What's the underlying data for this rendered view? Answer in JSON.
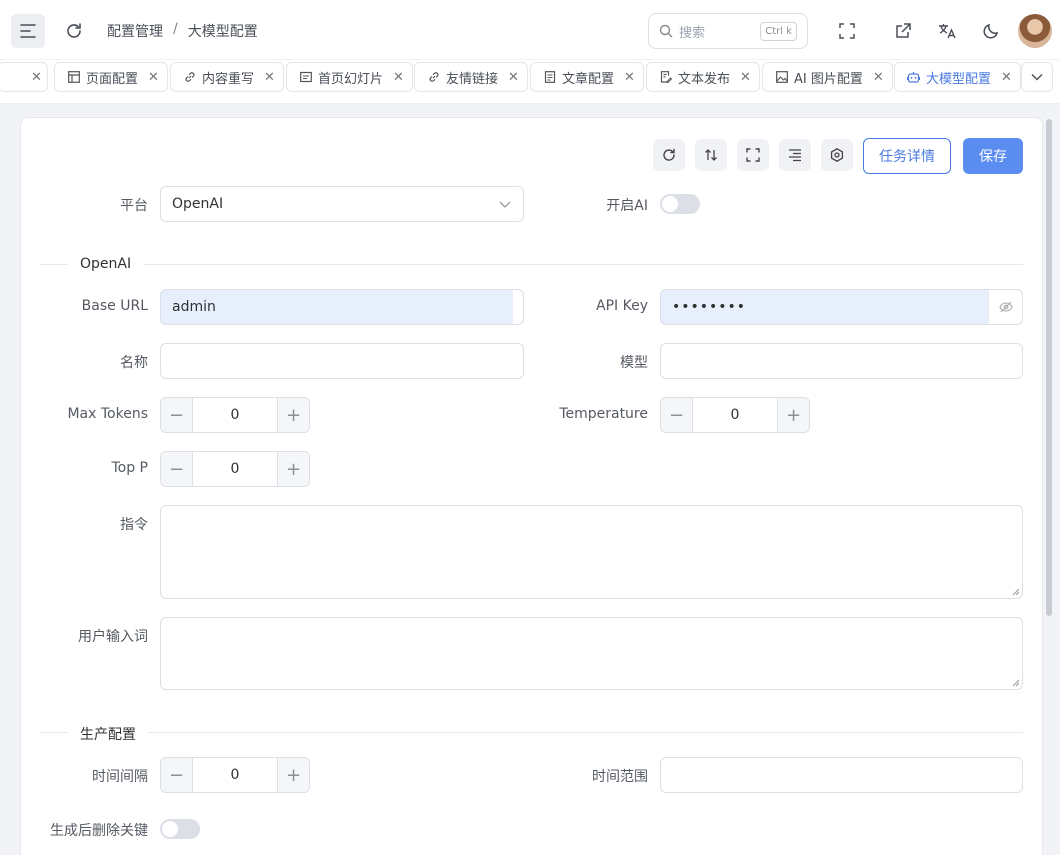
{
  "header": {
    "breadcrumb": [
      "配置管理",
      "大模型配置"
    ],
    "breadcrumb_sep": "/",
    "search": {
      "placeholder": "搜索",
      "shortcut": "Ctrl k"
    }
  },
  "tabs": [
    {
      "label": "页面配置",
      "icon": "layout-icon"
    },
    {
      "label": "内容重写",
      "icon": "link-icon"
    },
    {
      "label": "首页幻灯片",
      "icon": "slideshow-icon"
    },
    {
      "label": "友情链接",
      "icon": "link-icon"
    },
    {
      "label": "文章配置",
      "icon": "document-icon"
    },
    {
      "label": "文本发布",
      "icon": "document-edit-icon"
    },
    {
      "label": "AI 图片配置",
      "icon": "image-icon"
    },
    {
      "label": "大模型配置",
      "icon": "robot-icon",
      "active": true
    }
  ],
  "toolbar": {
    "task_detail_label": "任务详情",
    "save_label": "保存"
  },
  "form": {
    "platform_label": "平台",
    "platform_value": "OpenAI",
    "enable_ai_label": "开启AI",
    "enable_ai_on": false,
    "section_openai": "OpenAI",
    "base_url_label": "Base URL",
    "base_url_value": "admin",
    "api_key_label": "API Key",
    "api_key_value": "••••••••",
    "name_label": "名称",
    "model_label": "模型",
    "max_tokens_label": "Max Tokens",
    "max_tokens_value": "0",
    "temperature_label": "Temperature",
    "temperature_value": "0",
    "top_p_label": "Top P",
    "top_p_value": "0",
    "instruction_label": "指令",
    "user_input_label": "用户输入词",
    "section_production": "生产配置",
    "interval_label": "时间间隔",
    "interval_value": "0",
    "time_range_label": "时间范围",
    "delete_keyword_label": "生成后删除关键",
    "delete_keyword_on": false
  },
  "colors": {
    "accent": "#4a7be0",
    "primary_button": "#5b8cf0",
    "filled_input": "#e8effc"
  }
}
